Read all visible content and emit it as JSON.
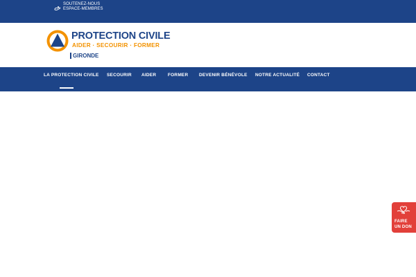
{
  "topbar": {
    "links": [
      "SOUTENEZ-NOUS",
      "ESPACE-MEMBRES"
    ]
  },
  "logo": {
    "title": "PROTECTION CIVILE",
    "tagline": "AIDER · SECOURIR · FORMER",
    "region": "GIRONDE"
  },
  "nav": {
    "items": [
      {
        "label": "LA PROTECTION CIVILE",
        "active": true
      },
      {
        "label": "SECOURIR",
        "active": false
      },
      {
        "label": "AIDER",
        "active": false
      },
      {
        "label": "FORMER",
        "active": false
      },
      {
        "label": "DEVENIR BÉNÉVOLE",
        "active": false
      },
      {
        "label": "NOTRE ACTUALITÉ",
        "active": false
      },
      {
        "label": "CONTACT",
        "active": false
      }
    ]
  },
  "donate": {
    "line1": "FAIRE",
    "line2": "UN DON",
    "icon": "heart-hand-icon"
  },
  "colors": {
    "brand_blue": "#1d4488",
    "brand_orange": "#f39200",
    "donate_red": "#e2403a"
  }
}
